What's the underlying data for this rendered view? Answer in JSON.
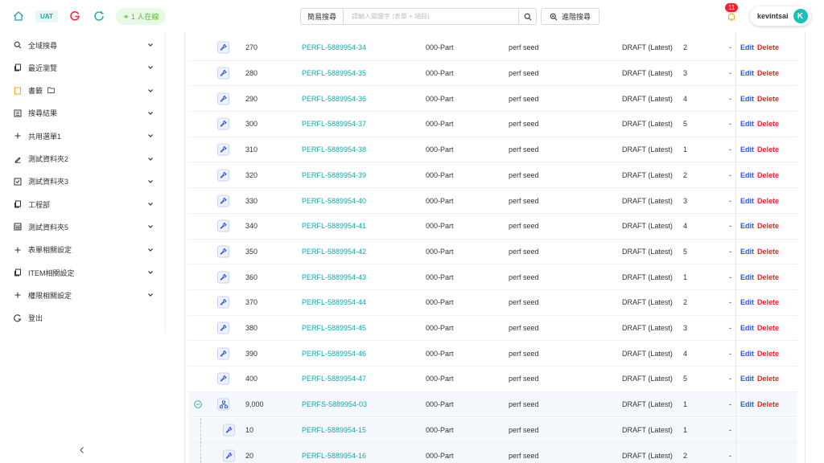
{
  "header": {
    "env_badge": "UAT",
    "online_text": "1 人在線",
    "search_type": "簡易搜尋",
    "search_placeholder": "請輸入關鍵字 (表單 + 項目)",
    "advanced_search_label": "進階搜尋",
    "notification_count": "11",
    "user_name": "kevintsai",
    "avatar_letter": "K"
  },
  "sidebar": {
    "items": [
      {
        "label": "全域搜尋",
        "icon": "search-icon",
        "chevron": true
      },
      {
        "label": "最近瀏覽",
        "icon": "copy-icon",
        "chevron": true
      },
      {
        "label": "書籤",
        "icon": "bookmark-icon",
        "chevron": true,
        "extra": "folder-icon"
      },
      {
        "label": "搜尋結果",
        "icon": "list-icon",
        "chevron": true
      },
      {
        "label": "共用選單1",
        "icon": "plus-icon",
        "chevron": true
      },
      {
        "label": "測試資料夾2",
        "icon": "edit-icon",
        "chevron": true
      },
      {
        "label": "測試資料夾3",
        "icon": "checkbox-icon",
        "chevron": true
      },
      {
        "label": "工程部",
        "icon": "copy-icon",
        "chevron": true
      },
      {
        "label": "測試資料夾5",
        "icon": "table-icon",
        "chevron": true
      },
      {
        "label": "表單相關設定",
        "icon": "plus-icon",
        "chevron": true
      },
      {
        "label": "ITEM相關設定",
        "icon": "copy-icon",
        "chevron": true
      },
      {
        "label": "權限相關設定",
        "icon": "plus-icon",
        "chevron": true
      },
      {
        "label": "登出",
        "icon": "logout-icon",
        "chevron": false
      }
    ]
  },
  "table": {
    "edit_label": "Edit",
    "delete_label": "Delete",
    "rows": [
      {
        "num": "270",
        "part": "PERFL-5889954-34",
        "type": "000-Part",
        "desc": "perf seed",
        "status": "DRAFT (Latest)",
        "rev": "2",
        "dash": "-",
        "actions": true,
        "kind": "part"
      },
      {
        "num": "280",
        "part": "PERFL-5889954-35",
        "type": "000-Part",
        "desc": "perf seed",
        "status": "DRAFT (Latest)",
        "rev": "3",
        "dash": "-",
        "actions": true,
        "kind": "part"
      },
      {
        "num": "290",
        "part": "PERFL-5889954-36",
        "type": "000-Part",
        "desc": "perf seed",
        "status": "DRAFT (Latest)",
        "rev": "4",
        "dash": "-",
        "actions": true,
        "kind": "part"
      },
      {
        "num": "300",
        "part": "PERFL-5889954-37",
        "type": "000-Part",
        "desc": "perf seed",
        "status": "DRAFT (Latest)",
        "rev": "5",
        "dash": "-",
        "actions": true,
        "kind": "part"
      },
      {
        "num": "310",
        "part": "PERFL-5889954-38",
        "type": "000-Part",
        "desc": "perf seed",
        "status": "DRAFT (Latest)",
        "rev": "1",
        "dash": "-",
        "actions": true,
        "kind": "part"
      },
      {
        "num": "320",
        "part": "PERFL-5889954-39",
        "type": "000-Part",
        "desc": "perf seed",
        "status": "DRAFT (Latest)",
        "rev": "2",
        "dash": "-",
        "actions": true,
        "kind": "part"
      },
      {
        "num": "330",
        "part": "PERFL-5889954-40",
        "type": "000-Part",
        "desc": "perf seed",
        "status": "DRAFT (Latest)",
        "rev": "3",
        "dash": "-",
        "actions": true,
        "kind": "part"
      },
      {
        "num": "340",
        "part": "PERFL-5889954-41",
        "type": "000-Part",
        "desc": "perf seed",
        "status": "DRAFT (Latest)",
        "rev": "4",
        "dash": "-",
        "actions": true,
        "kind": "part"
      },
      {
        "num": "350",
        "part": "PERFL-5889954-42",
        "type": "000-Part",
        "desc": "perf seed",
        "status": "DRAFT (Latest)",
        "rev": "5",
        "dash": "-",
        "actions": true,
        "kind": "part"
      },
      {
        "num": "360",
        "part": "PERFL-5889954-43",
        "type": "000-Part",
        "desc": "perf seed",
        "status": "DRAFT (Latest)",
        "rev": "1",
        "dash": "-",
        "actions": true,
        "kind": "part"
      },
      {
        "num": "370",
        "part": "PERFL-5889954-44",
        "type": "000-Part",
        "desc": "perf seed",
        "status": "DRAFT (Latest)",
        "rev": "2",
        "dash": "-",
        "actions": true,
        "kind": "part"
      },
      {
        "num": "380",
        "part": "PERFL-5889954-45",
        "type": "000-Part",
        "desc": "perf seed",
        "status": "DRAFT (Latest)",
        "rev": "3",
        "dash": "-",
        "actions": true,
        "kind": "part"
      },
      {
        "num": "390",
        "part": "PERFL-5889954-46",
        "type": "000-Part",
        "desc": "perf seed",
        "status": "DRAFT (Latest)",
        "rev": "4",
        "dash": "-",
        "actions": true,
        "kind": "part"
      },
      {
        "num": "400",
        "part": "PERFL-5889954-47",
        "type": "000-Part",
        "desc": "perf seed",
        "status": "DRAFT (Latest)",
        "rev": "5",
        "dash": "-",
        "actions": true,
        "kind": "part"
      },
      {
        "num": "9,000",
        "part": "PERFS-5889954-03",
        "type": "000-Part",
        "desc": "perf seed",
        "status": "DRAFT (Latest)",
        "rev": "1",
        "dash": "-",
        "actions": true,
        "kind": "assembly"
      },
      {
        "num": "10",
        "part": "PERFL-5889954-15",
        "type": "000-Part",
        "desc": "perf seed",
        "status": "DRAFT (Latest)",
        "rev": "1",
        "dash": "-",
        "actions": false,
        "kind": "child"
      },
      {
        "num": "20",
        "part": "PERFL-5889954-16",
        "type": "000-Part",
        "desc": "perf seed",
        "status": "DRAFT (Latest)",
        "rev": "2",
        "dash": "-",
        "actions": false,
        "kind": "child"
      }
    ]
  },
  "colors": {
    "accent": "#13a8a8",
    "edit": "#2f54eb",
    "delete": "#f5222d",
    "online": "#52c41a",
    "avatar": "#13c2b8"
  }
}
